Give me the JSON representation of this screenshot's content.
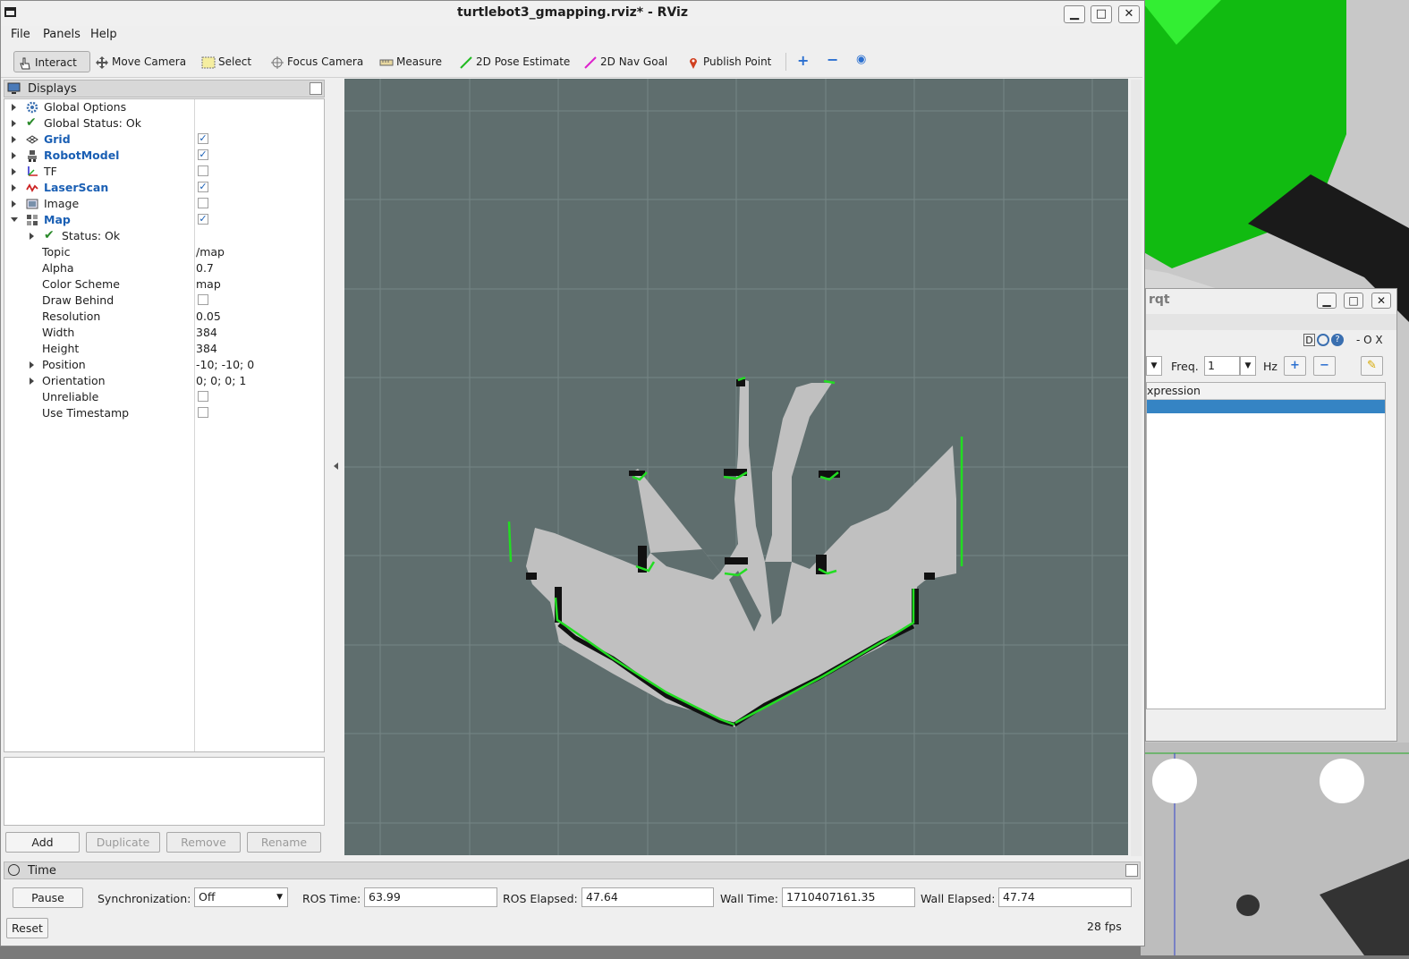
{
  "window": {
    "title": "turtlebot3_gmapping.rviz* - RViz",
    "min_label": "▁",
    "max_label": "□",
    "close_label": "✕"
  },
  "menu": [
    "File",
    "Panels",
    "Help"
  ],
  "toolbar": {
    "interact": "Interact",
    "move_camera": "Move Camera",
    "select": "Select",
    "focus_camera": "Focus Camera",
    "measure": "Measure",
    "pose_estimate": "2D Pose Estimate",
    "nav_goal": "2D Nav Goal",
    "publish_point": "Publish Point"
  },
  "displays": {
    "title": "Displays",
    "items": [
      {
        "label": "Global Options"
      },
      {
        "label": "Global Status: Ok"
      },
      {
        "label": "Grid",
        "checked": true
      },
      {
        "label": "RobotModel",
        "checked": true
      },
      {
        "label": "TF",
        "checked": false
      },
      {
        "label": "LaserScan",
        "checked": true
      },
      {
        "label": "Image",
        "checked": false
      },
      {
        "label": "Map",
        "checked": true
      }
    ],
    "map_props": [
      {
        "label": "Status: Ok",
        "value": ""
      },
      {
        "label": "Topic",
        "value": "/map"
      },
      {
        "label": "Alpha",
        "value": "0.7"
      },
      {
        "label": "Color Scheme",
        "value": "map"
      },
      {
        "label": "Draw Behind",
        "value": ""
      },
      {
        "label": "Resolution",
        "value": "0.05"
      },
      {
        "label": "Width",
        "value": "384"
      },
      {
        "label": "Height",
        "value": "384"
      },
      {
        "label": "Position",
        "value": "-10; -10; 0"
      },
      {
        "label": "Orientation",
        "value": "0; 0; 0; 1"
      },
      {
        "label": "Unreliable",
        "value": ""
      },
      {
        "label": "Use Timestamp",
        "value": ""
      }
    ],
    "buttons": {
      "add": "Add",
      "duplicate": "Duplicate",
      "remove": "Remove",
      "rename": "Rename"
    }
  },
  "time": {
    "title": "Time",
    "pause": "Pause",
    "sync_label": "Synchronization:",
    "sync_value": "Off",
    "ros_time_label": "ROS Time:",
    "ros_time": "63.99",
    "ros_elapsed_label": "ROS Elapsed:",
    "ros_elapsed": "47.64",
    "wall_time_label": "Wall Time:",
    "wall_time": "1710407161.35",
    "wall_elapsed_label": "Wall Elapsed:",
    "wall_elapsed": "47.74",
    "reset": "Reset",
    "fps": "28 fps"
  },
  "rqt": {
    "title": "rqt",
    "dots": "- O X",
    "freq_label": "Freq.",
    "freq_value": "1",
    "hz": "Hz",
    "expression_header": "xpression",
    "d_label": "D"
  },
  "colors": {
    "view_bg": "#5f6e6e",
    "map_free": "#c0c0c0",
    "laser": "#22dd22",
    "link_blue": "#1a5fb4"
  }
}
